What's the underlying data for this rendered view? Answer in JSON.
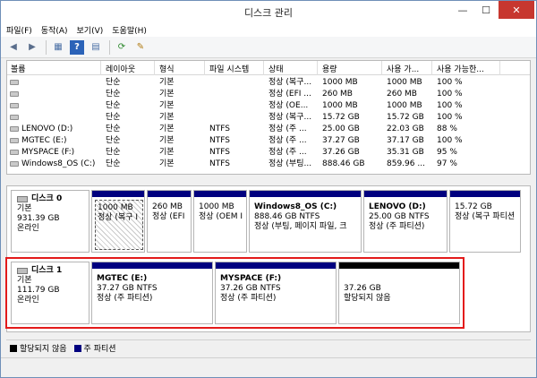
{
  "window": {
    "title": "디스크 관리",
    "minimize": "—",
    "maximize": "☐",
    "close": "✕"
  },
  "menu": [
    {
      "label": "파일(F)"
    },
    {
      "label": "동작(A)"
    },
    {
      "label": "보기(V)"
    },
    {
      "label": "도움말(H)"
    }
  ],
  "toolbar": {
    "back": "◀",
    "forward": "▶",
    "properties": "▦",
    "help": "?",
    "console": "▤",
    "refresh": "⟳",
    "rescan": "✎"
  },
  "volumes": {
    "columns": [
      "볼륨",
      "레이아웃",
      "형식",
      "파일 시스템",
      "상태",
      "용량",
      "사용 가...",
      "사용 가능한..."
    ],
    "rows": [
      {
        "volume": "",
        "layout": "단순",
        "type": "기본",
        "fs": "",
        "status": "정상 (복구...",
        "capacity": "1000 MB",
        "free": "1000 MB",
        "pct": "100 %"
      },
      {
        "volume": "",
        "layout": "단순",
        "type": "기본",
        "fs": "",
        "status": "정상 (EFI ...",
        "capacity": "260 MB",
        "free": "260 MB",
        "pct": "100 %"
      },
      {
        "volume": "",
        "layout": "단순",
        "type": "기본",
        "fs": "",
        "status": "정상 (OE...",
        "capacity": "1000 MB",
        "free": "1000 MB",
        "pct": "100 %"
      },
      {
        "volume": "",
        "layout": "단순",
        "type": "기본",
        "fs": "",
        "status": "정상 (복구...",
        "capacity": "15.72 GB",
        "free": "15.72 GB",
        "pct": "100 %"
      },
      {
        "volume": "LENOVO (D:)",
        "layout": "단순",
        "type": "기본",
        "fs": "NTFS",
        "status": "정상 (주 ...",
        "capacity": "25.00 GB",
        "free": "22.03 GB",
        "pct": "88 %"
      },
      {
        "volume": "MGTEC (E:)",
        "layout": "단순",
        "type": "기본",
        "fs": "NTFS",
        "status": "정상 (주 ...",
        "capacity": "37.27 GB",
        "free": "37.17 GB",
        "pct": "100 %"
      },
      {
        "volume": "MYSPACE (F:)",
        "layout": "단순",
        "type": "기본",
        "fs": "NTFS",
        "status": "정상 (주 ...",
        "capacity": "37.26 GB",
        "free": "35.31 GB",
        "pct": "95 %"
      },
      {
        "volume": "Windows8_OS (C:)",
        "layout": "단순",
        "type": "기본",
        "fs": "NTFS",
        "status": "정상 (부팅...",
        "capacity": "888.46 GB",
        "free": "859.96 ...",
        "pct": "97 %"
      }
    ]
  },
  "disks": [
    {
      "name": "디스크 0",
      "kind": "기본",
      "size": "931.39 GB",
      "state": "온라인",
      "partitions": [
        {
          "name": "",
          "size": "1000 MB",
          "desc": "정상 (복구 I",
          "unallocated": false
        },
        {
          "name": "",
          "size": "260 MB",
          "desc": "정상 (EFI",
          "unallocated": false
        },
        {
          "name": "",
          "size": "1000 MB",
          "desc": "정상 (OEM I",
          "unallocated": false
        },
        {
          "name": "Windows8_OS  (C:)",
          "size": "888.46 GB NTFS",
          "desc": "정상 (부팅, 페이지 파일, 크",
          "unallocated": false
        },
        {
          "name": "LENOVO  (D:)",
          "size": "25.00 GB NTFS",
          "desc": "정상 (주 파티션)",
          "unallocated": false
        },
        {
          "name": "",
          "size": "15.72 GB",
          "desc": "정상 (복구 파티션",
          "unallocated": false
        }
      ]
    },
    {
      "name": "디스크 1",
      "kind": "기본",
      "size": "111.79 GB",
      "state": "온라인",
      "partitions": [
        {
          "name": "MGTEC  (E:)",
          "size": "37.27 GB NTFS",
          "desc": "정상 (주 파티션)",
          "unallocated": false
        },
        {
          "name": "MYSPACE  (F:)",
          "size": "37.26 GB NTFS",
          "desc": "정상 (주 파티션)",
          "unallocated": false
        },
        {
          "name": "",
          "size": "37.26 GB",
          "desc": "할당되지 않음",
          "unallocated": true
        }
      ]
    }
  ],
  "legend": [
    {
      "label": "할당되지 않음",
      "color": "#000000"
    },
    {
      "label": "주 파티션",
      "color": "#00007f"
    }
  ]
}
